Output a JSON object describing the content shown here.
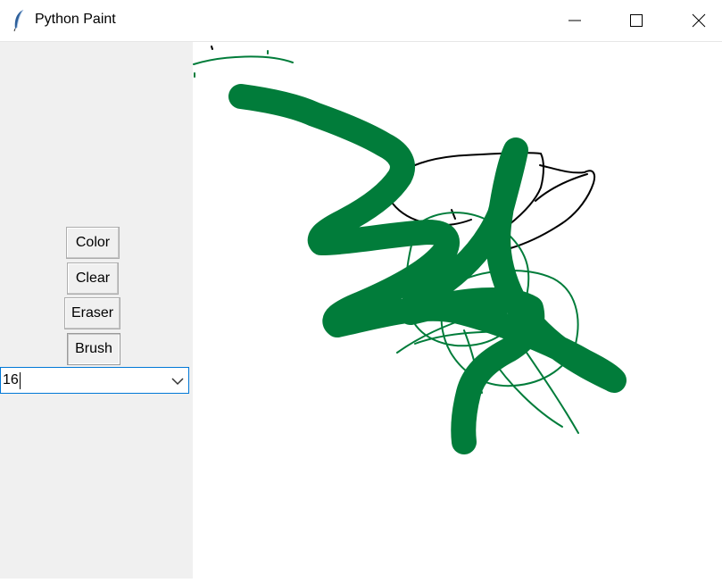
{
  "window": {
    "title": "Python Paint",
    "icon": "feather-icon",
    "controls": [
      "minimize-icon",
      "maximize-icon",
      "close-icon"
    ]
  },
  "toolbar": {
    "color_label": "Color",
    "clear_label": "Clear",
    "eraser_label": "Eraser",
    "brush_label": "Brush"
  },
  "brush_size": {
    "value": "16",
    "icon": "chevron-down-icon"
  },
  "colors": {
    "stroke_green": "#017c3a",
    "stroke_black": "#000000",
    "sidebar_bg": "#f0f0f0",
    "focus_border": "#0078d7"
  }
}
